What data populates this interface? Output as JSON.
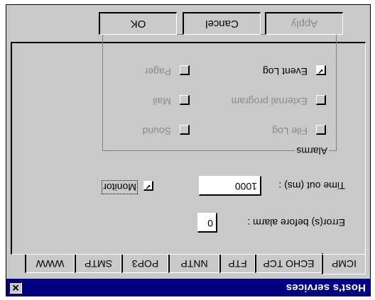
{
  "window": {
    "title": "Host's services",
    "close_glyph": "✕"
  },
  "tabs": [
    {
      "label": "ICMP",
      "active": true
    },
    {
      "label": "ECHO TCP"
    },
    {
      "label": "FTP"
    },
    {
      "label": "NNTP"
    },
    {
      "label": "POP3"
    },
    {
      "label": "SMTP"
    },
    {
      "label": "WWW"
    }
  ],
  "form": {
    "errors_label": "Error(s) before alarm :",
    "errors_value": "0",
    "timeout_label": "Time out (ms) :",
    "timeout_value": "1000",
    "monitor_label": "Monitor",
    "monitor_checked": true
  },
  "alarms": {
    "legend": "Alarms",
    "items": [
      {
        "label": "File Log",
        "checked": false,
        "enabled": false
      },
      {
        "label": "Sound",
        "checked": false,
        "enabled": false
      },
      {
        "label": "External program",
        "checked": false,
        "enabled": false
      },
      {
        "label": "Mail",
        "checked": false,
        "enabled": false
      },
      {
        "label": "Event Log",
        "checked": true,
        "enabled": true
      },
      {
        "label": "Pager",
        "checked": false,
        "enabled": false
      }
    ]
  },
  "buttons": {
    "ok": "OK",
    "cancel": "Cancel",
    "apply": "Apply"
  },
  "colors": {
    "titlebar": "#000080",
    "face": "#c9c9c9",
    "disabled_text": "#8a8a8a"
  }
}
